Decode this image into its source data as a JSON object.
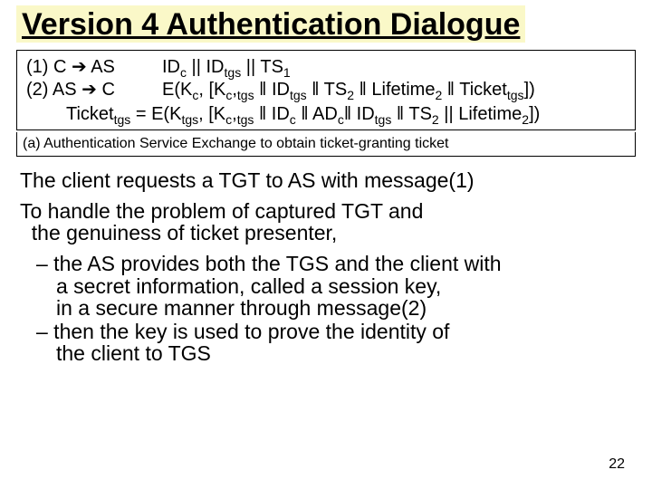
{
  "title": "Version 4 Authentication Dialogue",
  "box": {
    "row1_label_a": "(1)  C ",
    "row1_label_b": " AS",
    "row1_body": "IDc || IDtgs || TS1",
    "row2_label_a": "(2)  AS ",
    "row2_label_b": " C",
    "row2_body": "E(Kc, [Kc, tgs ‖ IDtgs ‖ TS2 ‖ Lifetime2 ‖ Tickettgs])",
    "row3": "Tickettgs = E(Ktgs, [Kc, tgs ‖ IDc ‖ ADc‖ IDtgs ‖ TS2 || Lifetime2])"
  },
  "box2": "(a) Authentication Service Exchange to obtain ticket-granting ticket",
  "p1": "The client requests a TGT to AS with message(1)",
  "p2a": "To handle the problem of captured TGT and",
  "p2b": "the genuiness of ticket presenter,",
  "b1a": "– the AS provides both the TGS and the client with",
  "b1b": "a secret information, called a session key,",
  "b1c": "in a secure manner through message(2)",
  "b2a": "– then the key is used to prove the identity of",
  "b2b": "the client to TGS",
  "pagenum": "22"
}
